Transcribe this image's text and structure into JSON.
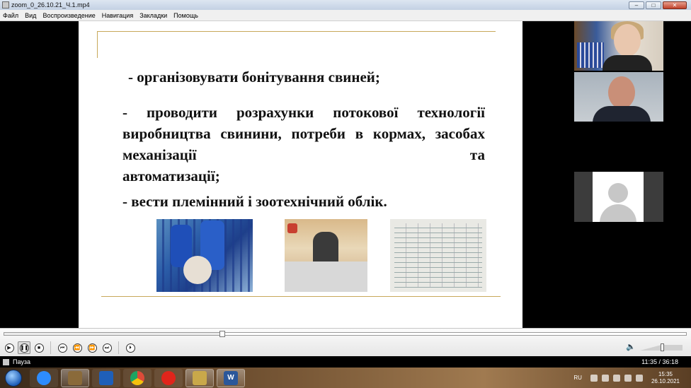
{
  "window": {
    "title": "zoom_0_26.10.21_Ч.1.mp4",
    "controls": {
      "minimize": "–",
      "maximize": "□",
      "close": "✕"
    }
  },
  "menu": {
    "items": [
      "Файл",
      "Вид",
      "Воспроизведение",
      "Навигация",
      "Закладки",
      "Помощь"
    ]
  },
  "slide": {
    "bullet_1": "-  організовувати  бонітування свиней;",
    "bullet_2": "-          проводити  розрахунки  потокової технології виробництва свинини, потреби в кормах,       засобах    механізації    та",
    "bullet_2_end": "автоматизації;",
    "bullet_3": "-  вести племінний і зоотехнічний облік."
  },
  "player": {
    "progress_fraction": 0.32,
    "buttons": {
      "play": "▶",
      "pause": "❚❚",
      "stop": "■",
      "prev": "⏮",
      "rewind": "⏪",
      "forward": "⏩",
      "next": "⏭",
      "frame": "⏵"
    },
    "volume_fraction": 0.95
  },
  "status": {
    "state": "Пауза",
    "time": "11:35 / 36:18"
  },
  "taskbar": {
    "items": [
      {
        "icon": "zoom-icon",
        "label": "",
        "color": "#2d8cff"
      },
      {
        "icon": "media-player-icon",
        "label": "",
        "color": "#8a6a3a"
      },
      {
        "icon": "save-icon",
        "label": "",
        "color": "#1f5fb8"
      },
      {
        "icon": "chrome-icon",
        "label": "",
        "color": "#dd4b39"
      },
      {
        "icon": "opera-icon",
        "label": "",
        "color": "#e0251b"
      },
      {
        "icon": "film-icon",
        "label": "",
        "color": "#c9a84a"
      },
      {
        "icon": "word-icon",
        "label": "W",
        "color": "#2b579a"
      }
    ],
    "tray": {
      "lang": "RU",
      "time": "15:35",
      "date": "26.10.2021"
    }
  },
  "colors": {
    "slide_rule": "#c8a85a",
    "title_bar": "#c3d1e4",
    "accent": "#1f5fb8"
  }
}
